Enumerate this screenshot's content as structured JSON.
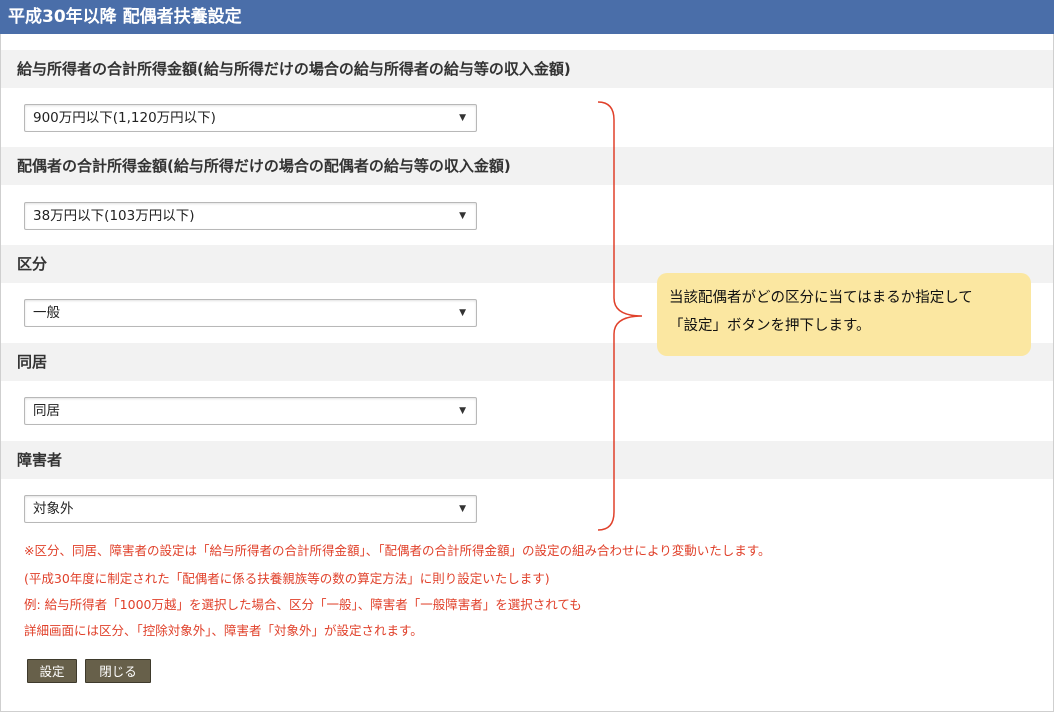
{
  "window": {
    "title": "平成30年以降 配偶者扶養設定"
  },
  "fields": [
    {
      "label": "給与所得者の合計所得金額(給与所得だけの場合の給与所得者の給与等の収入金額)",
      "value": "900万円以下(1,120万円以下)"
    },
    {
      "label": "配偶者の合計所得金額(給与所得だけの場合の配偶者の給与等の収入金額)",
      "value": "38万円以下(103万円以下)"
    },
    {
      "label": "区分",
      "value": "一般"
    },
    {
      "label": "同居",
      "value": "同居"
    },
    {
      "label": "障害者",
      "value": "対象外"
    }
  ],
  "notes": [
    "※区分、同居、障害者の設定は「給与所得者の合計所得金額」、「配偶者の合計所得金額」の設定の組み合わせにより変動いたします。",
    "(平成30年度に制定された「配偶者に係る扶養親族等の数の算定方法」に則り設定いたします)",
    "例: 給与所得者「1000万越」を選択した場合、区分「一般」、障害者「一般障害者」を選択されても",
    "詳細画面には区分、「控除対象外」、障害者「対象外」が設定されます。"
  ],
  "buttons": {
    "set": "設定",
    "close": "閉じる"
  },
  "callout": {
    "line1": "当該配偶者がどの区分に当てはまるか指定して",
    "line2": "「設定」ボタンを押下します。"
  },
  "colors": {
    "titlebar": "#4a6ea9",
    "note_text": "#e0402a",
    "brace": "#e0402a",
    "callout_bg": "#fbe7a1",
    "button_bg": "#67604a"
  },
  "icons": {
    "select_caret": "dropdown-caret-icon"
  }
}
